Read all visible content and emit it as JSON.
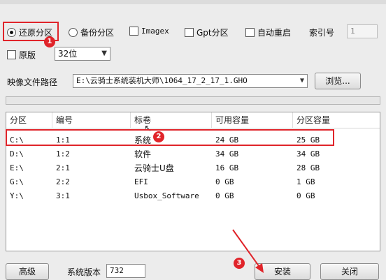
{
  "window": {
    "title": ""
  },
  "options": {
    "restore_partition": "还原分区",
    "backup_partition": "备份分区",
    "imagex": "Imagex",
    "gpt_partition": "Gpt分区",
    "auto_restart": "自动重启",
    "index_label": "索引号",
    "index_value": "1",
    "original": "原版",
    "bitness_selected": "32位"
  },
  "image_path": {
    "label": "映像文件路径",
    "value": "E:\\云骑士系统装机大师\\1064_17_2_17_1.GHO",
    "browse_label": "浏览..."
  },
  "table": {
    "columns": [
      "分区",
      "编号",
      "标卷",
      "可用容量",
      "分区容量"
    ],
    "rows": [
      [
        "C:\\",
        "1:1",
        "系统",
        "24 GB",
        "25 GB"
      ],
      [
        "D:\\",
        "1:2",
        "软件",
        "34 GB",
        "34 GB"
      ],
      [
        "E:\\",
        "2:1",
        "云骑士U盘",
        "16 GB",
        "28 GB"
      ],
      [
        "G:\\",
        "2:2",
        "EFI",
        "0 GB",
        "1 GB"
      ],
      [
        "Y:\\",
        "3:1",
        "Usbox_Software",
        "0 GB",
        "0 GB"
      ]
    ]
  },
  "footer": {
    "advanced_label": "高级",
    "version_label": "系统版本",
    "version_value": "732",
    "install_label": "安装",
    "close_label": "关闭"
  },
  "annotations": {
    "step1": "1",
    "step2": "2",
    "step3": "3"
  },
  "colors": {
    "annotation_red": "#e0242a",
    "window_bg": "#ececec"
  }
}
